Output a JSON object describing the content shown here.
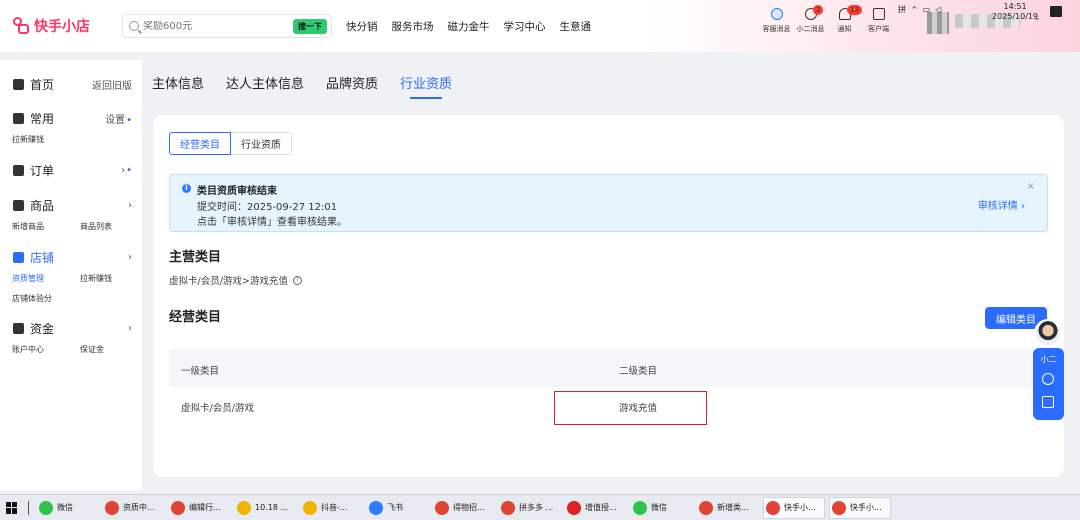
{
  "header": {
    "logo_text": "快手小店",
    "search_placeholder": "奖励600元",
    "search_button": "搜一下",
    "nav": [
      "快分销",
      "服务市场",
      "磁力金牛",
      "学习中心",
      "生意通"
    ],
    "icons": [
      {
        "label": "客服消息",
        "icon": "robot-icon",
        "badge": ""
      },
      {
        "label": "小二消息",
        "icon": "chat-icon",
        "badge": "2"
      },
      {
        "label": "通知",
        "icon": "bell-icon",
        "badge": "13"
      },
      {
        "label": "客户端",
        "icon": "monitor-icon",
        "badge": ""
      }
    ]
  },
  "sidebar": {
    "home": {
      "label": "首页",
      "right": "返回旧版"
    },
    "common": {
      "label": "常用",
      "right": "设置",
      "subs": [
        "拉新赚钱"
      ]
    },
    "orders": {
      "label": "订单",
      "right": "›"
    },
    "products": {
      "label": "商品",
      "right": "›",
      "subs": [
        "新增商品",
        "商品列表"
      ]
    },
    "store": {
      "label": "店铺",
      "right": "›",
      "subs": [
        "资质管理",
        "拉新赚钱",
        "店铺体验分"
      ]
    },
    "funds": {
      "label": "资金",
      "right": "›",
      "subs": [
        "账户中心",
        "保证金"
      ]
    }
  },
  "page_tabs": [
    "主体信息",
    "达人主体信息",
    "品牌资质",
    "行业资质"
  ],
  "active_page_tab": "行业资质",
  "sub_tabs": [
    "经营类目",
    "行业资质"
  ],
  "notice": {
    "title": "类目资质审核结束",
    "time": "提交时间：2025-09-27 12:01",
    "tip": "点击「审核详情」查看审核结果。",
    "link": "审核详情 ›",
    "close": "×"
  },
  "main_category": {
    "heading": "主营类目",
    "path": "虚拟卡/会员/游戏>游戏充值"
  },
  "business_category": {
    "heading": "经营类目",
    "edit_button": "编辑类目",
    "columns": [
      "一级类目",
      "二级类目"
    ],
    "rows": [
      [
        "虚拟卡/会员/游戏",
        "游戏充值"
      ]
    ]
  },
  "assistant": {
    "label": "小二"
  },
  "taskbar": {
    "items": [
      {
        "label": "微信",
        "color": "#2ec24a"
      },
      {
        "label": "资质中...",
        "color": "#e04434"
      },
      {
        "label": "编辑行...",
        "color": "#e04434"
      },
      {
        "label": "10.18 ...",
        "color": "#f0b400"
      },
      {
        "label": "抖音-...",
        "color": "#f0b400"
      },
      {
        "label": "飞书",
        "color": "#2b7cff"
      },
      {
        "label": "得物招...",
        "color": "#e04434"
      },
      {
        "label": "拼多多 ...",
        "color": "#e04434"
      },
      {
        "label": "增值授...",
        "color": "#d22"
      },
      {
        "label": "微信",
        "color": "#2ec24a"
      },
      {
        "label": "新增类...",
        "color": "#e04434"
      },
      {
        "label": "快手小...",
        "color": "#e04434"
      },
      {
        "label": "快手小...",
        "color": "#e04434"
      }
    ],
    "ime": "拼",
    "time": "14:51",
    "date": "2025/10/19"
  }
}
